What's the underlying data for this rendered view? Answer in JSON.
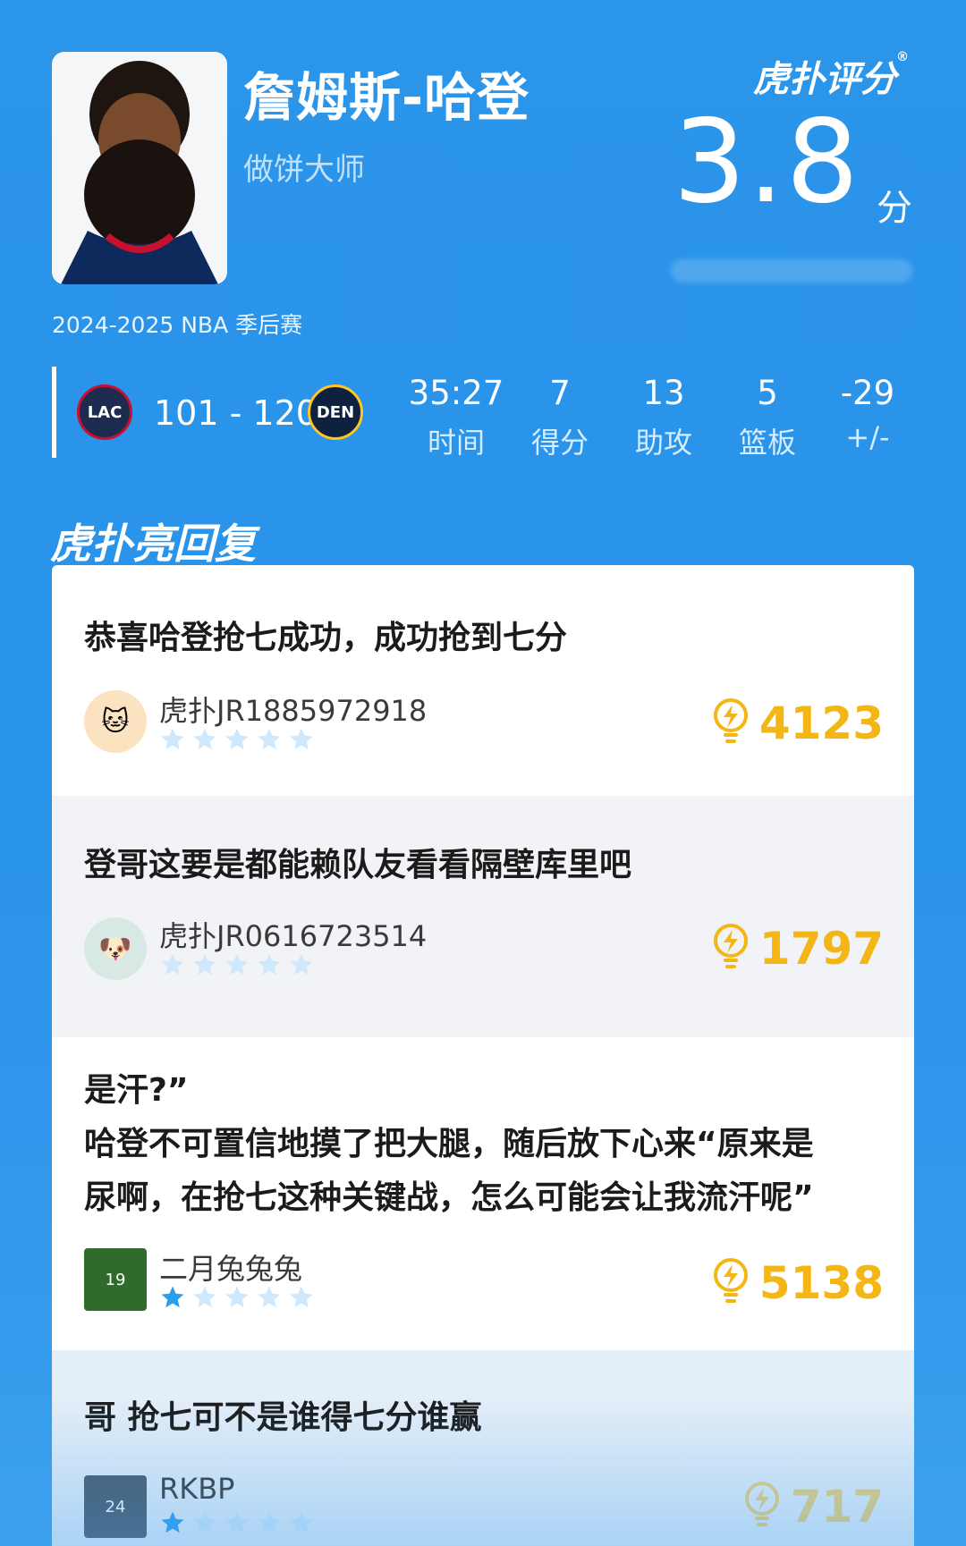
{
  "player": {
    "name": "詹姆斯-哈登",
    "nickname": "做饼大师",
    "season": "2024-2025 NBA 季后赛"
  },
  "brand": {
    "label": "虎扑评分",
    "reg": "®"
  },
  "rating": {
    "score": "3.8",
    "unit": "分"
  },
  "match": {
    "home_team": "LAC",
    "away_team": "DEN",
    "score": "101 - 120",
    "stats": [
      {
        "value": "35:27",
        "label": "时间"
      },
      {
        "value": "7",
        "label": "得分"
      },
      {
        "value": "13",
        "label": "助攻"
      },
      {
        "value": "5",
        "label": "篮板"
      },
      {
        "value": "-29",
        "label": "+/-"
      }
    ]
  },
  "section": {
    "title": "虎扑亮回复"
  },
  "comments": [
    {
      "text_lines": [
        "恭喜哈登抢七成功，成功抢到七分"
      ],
      "user": "虎扑JR1885972918",
      "stars": 0,
      "likes": "4123"
    },
    {
      "text_lines": [
        "登哥这要是都能赖队友看看隔壁库里吧"
      ],
      "user": "虎扑JR0616723514",
      "stars": 0,
      "likes": "1797"
    },
    {
      "text_lines": [
        " 是汗?”",
        "哈登不可置信地摸了把大腿，随后放下心来“原来是",
        "尿啊，在抢七这种关键战，怎么可能会让我流汗呢”"
      ],
      "user": "二月兔兔兔",
      "stars": 1,
      "likes": "5138"
    },
    {
      "text_lines": [
        "哥 抢七可不是谁得七分谁赢"
      ],
      "user": "RKBP",
      "stars": 1,
      "likes": "717"
    }
  ],
  "colors": {
    "accent": "#2b95ea",
    "like": "#f3b614",
    "star_on": "#2a9ff0",
    "star_off": "#cfe8fb"
  }
}
